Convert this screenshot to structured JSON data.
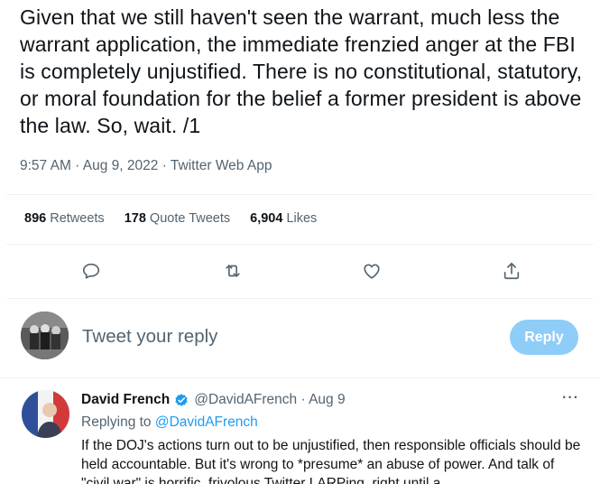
{
  "tweet": {
    "text": "Given that we still haven't seen the warrant, much less the warrant application, the immediate frenzied anger at the FBI is completely unjustified. There is no constitutional, statutory, or moral foundation for the belief a former president is above the law. So, wait. /1",
    "meta": "9:57 AM · Aug 9, 2022 · Twitter Web App"
  },
  "stats": {
    "retweets_count": "896",
    "retweets_label": "Retweets",
    "quotes_count": "178",
    "quotes_label": "Quote Tweets",
    "likes_count": "6,904",
    "likes_label": "Likes"
  },
  "actions": {
    "icons": [
      "reply-icon",
      "retweet-icon",
      "like-icon",
      "share-icon"
    ]
  },
  "composer": {
    "placeholder": "Tweet your reply",
    "button_label": "Reply"
  },
  "reply": {
    "name": "David French",
    "handle_time": "@DavidAFrench · Aug 9",
    "more": "···",
    "replying_prefix": "Replying to",
    "replying_handle": "@DavidAFrench",
    "body": "If the DOJ's actions turn out to be unjustified, then responsible officials should be held accountable. But it's wrong to *presume* an abuse of power. And talk of \"civil war\" is horrific, frivolous Twitter LARPing, right until a"
  },
  "colors": {
    "accent": "#1d9bf0",
    "reply_button_disabled": "#8ecdf8",
    "secondary_text": "#536471"
  }
}
